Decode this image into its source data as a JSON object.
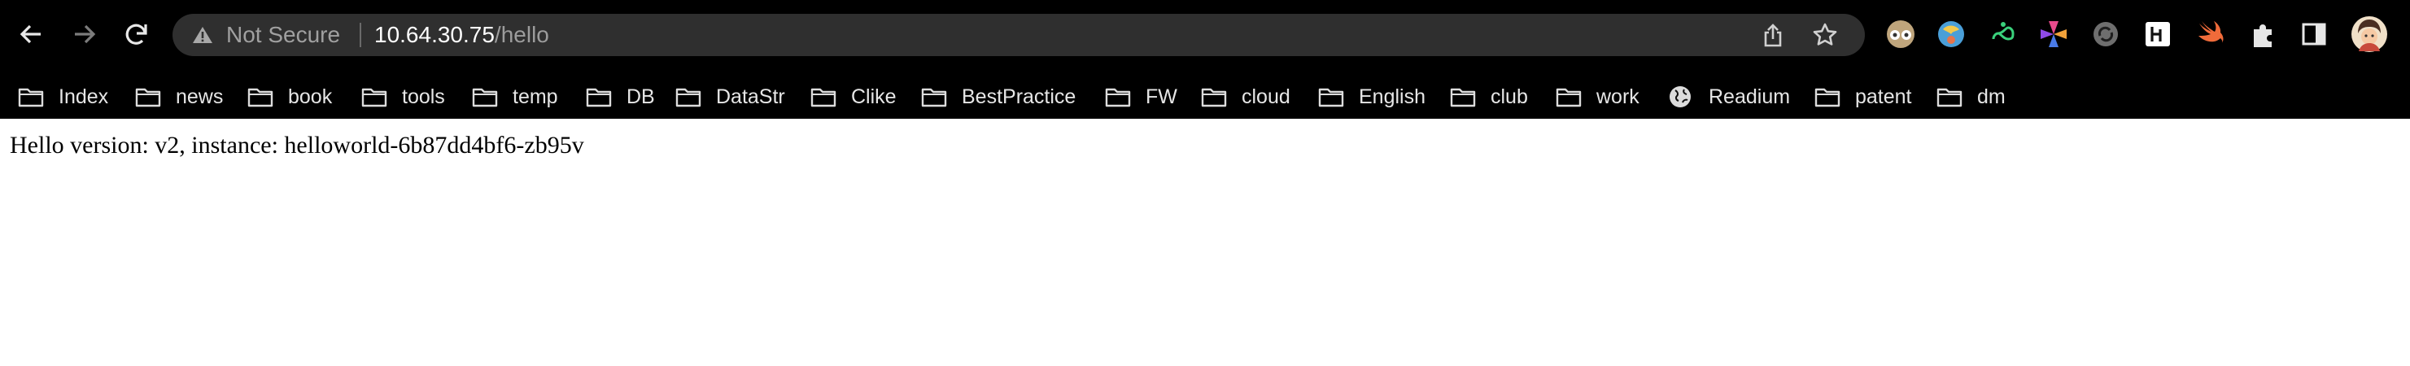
{
  "toolbar": {
    "security_label": "Not Secure",
    "url_host": "10.64.30.75",
    "url_path": "/hello"
  },
  "bookmarks": [
    {
      "label": "Index",
      "icon": "folder-icon"
    },
    {
      "label": "news",
      "icon": "folder-icon"
    },
    {
      "label": "book",
      "icon": "folder-icon"
    },
    {
      "label": "tools",
      "icon": "folder-icon"
    },
    {
      "label": "temp",
      "icon": "folder-icon"
    },
    {
      "label": "DB",
      "icon": "folder-icon"
    },
    {
      "label": "DataStr",
      "icon": "folder-icon"
    },
    {
      "label": "Clike",
      "icon": "folder-icon"
    },
    {
      "label": "BestPractice",
      "icon": "folder-icon"
    },
    {
      "label": "FW",
      "icon": "folder-icon"
    },
    {
      "label": "cloud",
      "icon": "folder-icon"
    },
    {
      "label": "English",
      "icon": "folder-icon"
    },
    {
      "label": "club",
      "icon": "folder-icon"
    },
    {
      "label": "work",
      "icon": "folder-icon"
    },
    {
      "label": "Readium",
      "icon": "globe-icon"
    },
    {
      "label": "patent",
      "icon": "folder-icon"
    },
    {
      "label": "dm",
      "icon": "folder-icon"
    }
  ],
  "page": {
    "message": "Hello version: v2, instance: helloworld-6b87dd4bf6-zb95v"
  }
}
